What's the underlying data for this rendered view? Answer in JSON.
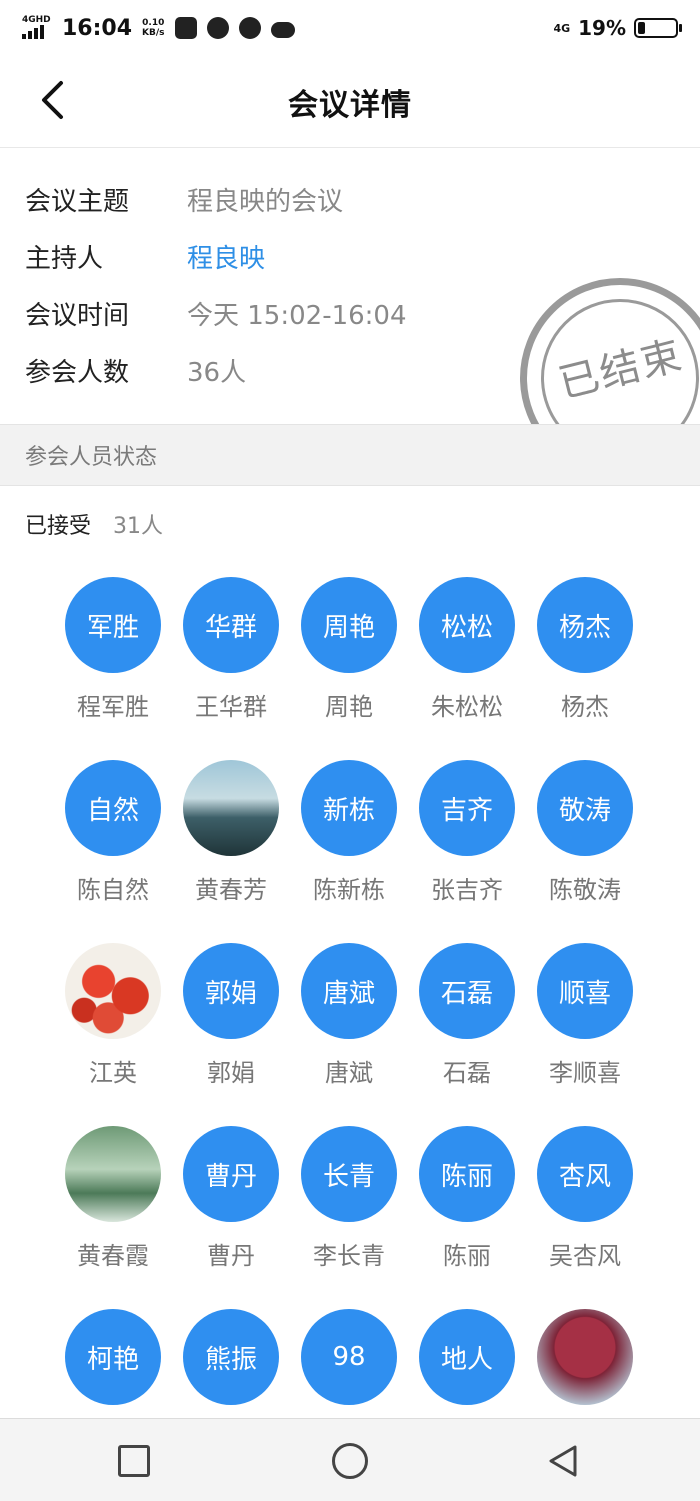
{
  "status_bar": {
    "network": "4GHD",
    "time": "16:04",
    "speed_value": "0.10",
    "speed_unit": "KB/s",
    "network_right": "4G",
    "battery_percent": "19%",
    "icons": [
      "notification-icon",
      "wechat-icon",
      "app-icon",
      "cloud-icon"
    ]
  },
  "header": {
    "title": "会议详情",
    "back_icon": "chevron-left-icon"
  },
  "meeting": {
    "rows": [
      {
        "label": "会议主题",
        "value": "程良映的会议"
      },
      {
        "label": "主持人",
        "value": "程良映"
      },
      {
        "label": "会议时间",
        "value": "今天 15:02-16:04"
      },
      {
        "label": "参会人数",
        "value": "36人"
      }
    ],
    "stamp": "已结束"
  },
  "attendees": {
    "section_title": "参会人员状态",
    "accepted_label": "已接受",
    "accepted_count": "31人",
    "people": [
      {
        "avatar": "军胜",
        "name": "程军胜"
      },
      {
        "avatar": "华群",
        "name": "王华群"
      },
      {
        "avatar": "周艳",
        "name": "周艳"
      },
      {
        "avatar": "松松",
        "name": "朱松松"
      },
      {
        "avatar": "杨杰",
        "name": "杨杰"
      },
      {
        "avatar": "自然",
        "name": "陈自然"
      },
      {
        "avatar": "",
        "name": "黄春芳",
        "photo": "lake"
      },
      {
        "avatar": "新栋",
        "name": "陈新栋"
      },
      {
        "avatar": "吉齐",
        "name": "张吉齐"
      },
      {
        "avatar": "敬涛",
        "name": "陈敬涛"
      },
      {
        "avatar": "",
        "name": "江英",
        "photo": "strawberry"
      },
      {
        "avatar": "郭娟",
        "name": "郭娟"
      },
      {
        "avatar": "唐斌",
        "name": "唐斌"
      },
      {
        "avatar": "石磊",
        "name": "石磊"
      },
      {
        "avatar": "顺喜",
        "name": "李顺喜"
      },
      {
        "avatar": "",
        "name": "黄春霞",
        "photo": "green"
      },
      {
        "avatar": "曹丹",
        "name": "曹丹"
      },
      {
        "avatar": "长青",
        "name": "李长青"
      },
      {
        "avatar": "陈丽",
        "name": "陈丽"
      },
      {
        "avatar": "杏风",
        "name": "吴杏风"
      },
      {
        "avatar": "柯艳",
        "name": ""
      },
      {
        "avatar": "熊振",
        "name": ""
      },
      {
        "avatar": "98",
        "name": ""
      },
      {
        "avatar": "地人",
        "name": ""
      },
      {
        "avatar": "",
        "name": "",
        "photo": "tree"
      }
    ]
  },
  "nav": {
    "icons": [
      "recent-apps-icon",
      "home-icon",
      "back-icon"
    ]
  },
  "colors": {
    "accent": "#2f8ff0",
    "link": "#2e8fe6",
    "muted_text": "#888888",
    "section_bg": "#f2f2f2"
  }
}
